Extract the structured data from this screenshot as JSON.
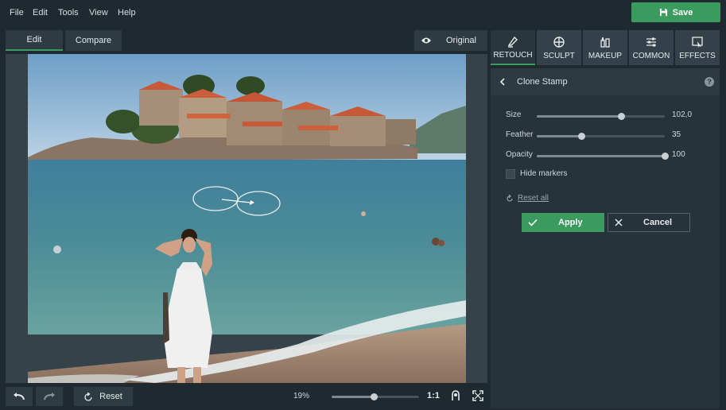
{
  "menu": [
    "File",
    "Edit",
    "Tools",
    "View",
    "Help"
  ],
  "save_label": "Save",
  "toolbar": {
    "edit_tab": "Edit",
    "compare_tab": "Compare",
    "original_label": "Original"
  },
  "categories": [
    {
      "label": "RETOUCH",
      "icon": "retouch-icon",
      "active": true
    },
    {
      "label": "SCULPT",
      "icon": "sculpt-icon",
      "active": false
    },
    {
      "label": "MAKEUP",
      "icon": "makeup-icon",
      "active": false
    },
    {
      "label": "COMMON",
      "icon": "common-icon",
      "active": false
    },
    {
      "label": "EFFECTS",
      "icon": "effects-icon",
      "active": false
    }
  ],
  "tool": {
    "title": "Clone Stamp",
    "help": "?",
    "sliders": [
      {
        "label": "Size",
        "value": "102,0",
        "fraction": 0.66
      },
      {
        "label": "Feather",
        "value": "35",
        "fraction": 0.35
      },
      {
        "label": "Opacity",
        "value": "100",
        "fraction": 1.0
      }
    ],
    "hide_markers": "Hide markers",
    "reset_all": "Reset all",
    "apply": "Apply",
    "cancel": "Cancel"
  },
  "bottom": {
    "reset": "Reset",
    "zoom": "19%",
    "zoom_fraction": 0.48,
    "one_to_one": "1:1"
  },
  "colors": {
    "accent": "#3b9a5e",
    "background": "#1e2a30",
    "panel": "#27333a"
  }
}
